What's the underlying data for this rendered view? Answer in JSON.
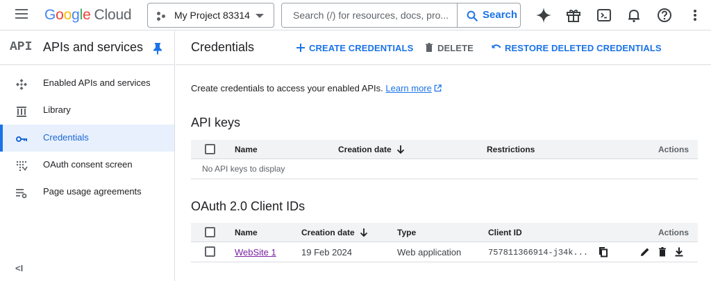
{
  "topbar": {
    "logo": {
      "letters": [
        "G",
        "o",
        "o",
        "g",
        "l",
        "e"
      ],
      "suffix": "Cloud"
    },
    "project_name": "My Project 83314",
    "search_placeholder": "Search (/) for resources, docs, pro...",
    "search_button": "Search",
    "icons": [
      "gemini-sparkle-icon",
      "gift-icon",
      "cloud-shell-icon",
      "notifications-icon",
      "help-icon",
      "more-vert-icon"
    ]
  },
  "sidebar": {
    "logo_text": "API",
    "title": "APIs and services",
    "items": [
      {
        "label": "Enabled APIs and services",
        "icon": "enabled-apis-icon",
        "active": false
      },
      {
        "label": "Library",
        "icon": "library-icon",
        "active": false
      },
      {
        "label": "Credentials",
        "icon": "key-icon",
        "active": true
      },
      {
        "label": "OAuth consent screen",
        "icon": "oauth-consent-icon",
        "active": false
      },
      {
        "label": "Page usage agreements",
        "icon": "settings-list-icon",
        "active": false
      }
    ],
    "collapse_label": "<I"
  },
  "header": {
    "title": "Credentials",
    "create_label": "CREATE CREDENTIALS",
    "delete_label": "DELETE",
    "restore_label": "RESTORE DELETED CREDENTIALS"
  },
  "content": {
    "intro_text": "Create credentials to access your enabled APIs.",
    "learn_more": "Learn more",
    "api_keys": {
      "title": "API keys",
      "columns": {
        "name": "Name",
        "creation_date": "Creation date",
        "restrictions": "Restrictions",
        "actions": "Actions"
      },
      "empty_text": "No API keys to display"
    },
    "oauth": {
      "title": "OAuth 2.0 Client IDs",
      "columns": {
        "name": "Name",
        "creation_date": "Creation date",
        "type": "Type",
        "client_id": "Client ID",
        "actions": "Actions"
      },
      "rows": [
        {
          "name": "WebSite 1",
          "creation_date": "19 Feb 2024",
          "type": "Web application",
          "client_id": "757811366914-j34k..."
        }
      ]
    }
  },
  "colors": {
    "accent": "#1a73e8",
    "active_bg": "#e8f0fe",
    "link_visited": "#7b1fa2",
    "header_bg": "#f1f3f4"
  }
}
